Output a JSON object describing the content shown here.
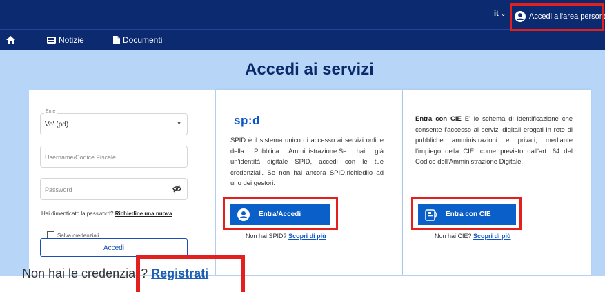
{
  "header": {
    "language": "it",
    "account_label": "Accedi all'area personale"
  },
  "nav": {
    "items": [
      {
        "label": "Notizie"
      },
      {
        "label": "Documenti"
      }
    ]
  },
  "page_title": "Accedi ai servizi",
  "login": {
    "ente_label": "Ente",
    "ente_value": "Vo' (pd)",
    "username_placeholder": "Username/Codice Fiscale",
    "password_placeholder": "Password",
    "forgot_text": "Hai dimenticato la password?",
    "forgot_link": "Richiedine una nuova",
    "save_label": "Salva credenziali",
    "submit_label": "Accedi"
  },
  "spid": {
    "logo_text": "sp:d",
    "description": "SPID è il sistema unico di accesso ai servizi online della Pubblica Amministrazione.Se hai già un'identità digitale SPID, accedi con le tue credenziali. Se non hai ancora SPID,richiedilo ad uno dei gestori.",
    "button_label": "Entra/Accedi",
    "no_account_text": "Non hai SPID?",
    "learn_more": "Scopri di più"
  },
  "cie": {
    "title": "Entra con CIE",
    "description": "E' lo schema di identificazione che consente l'accesso ai servizi digitali erogati in rete di pubbliche amministrazioni e privati, mediante l'impiego della CIE, come previsto dall'art. 64 del Codice dell'Amministrazione Digitale.",
    "button_label": "Entra con CIE",
    "no_account_text": "Non hai CIE?",
    "learn_more": "Scopri di più"
  },
  "register": {
    "text": "Non hai le credenziali?",
    "link": "Registrati"
  },
  "colors": {
    "header_bg": "#0b2a70",
    "hero_bg": "#b7d5f7",
    "primary": "#0b5fc8",
    "highlight": "#e4201e"
  }
}
